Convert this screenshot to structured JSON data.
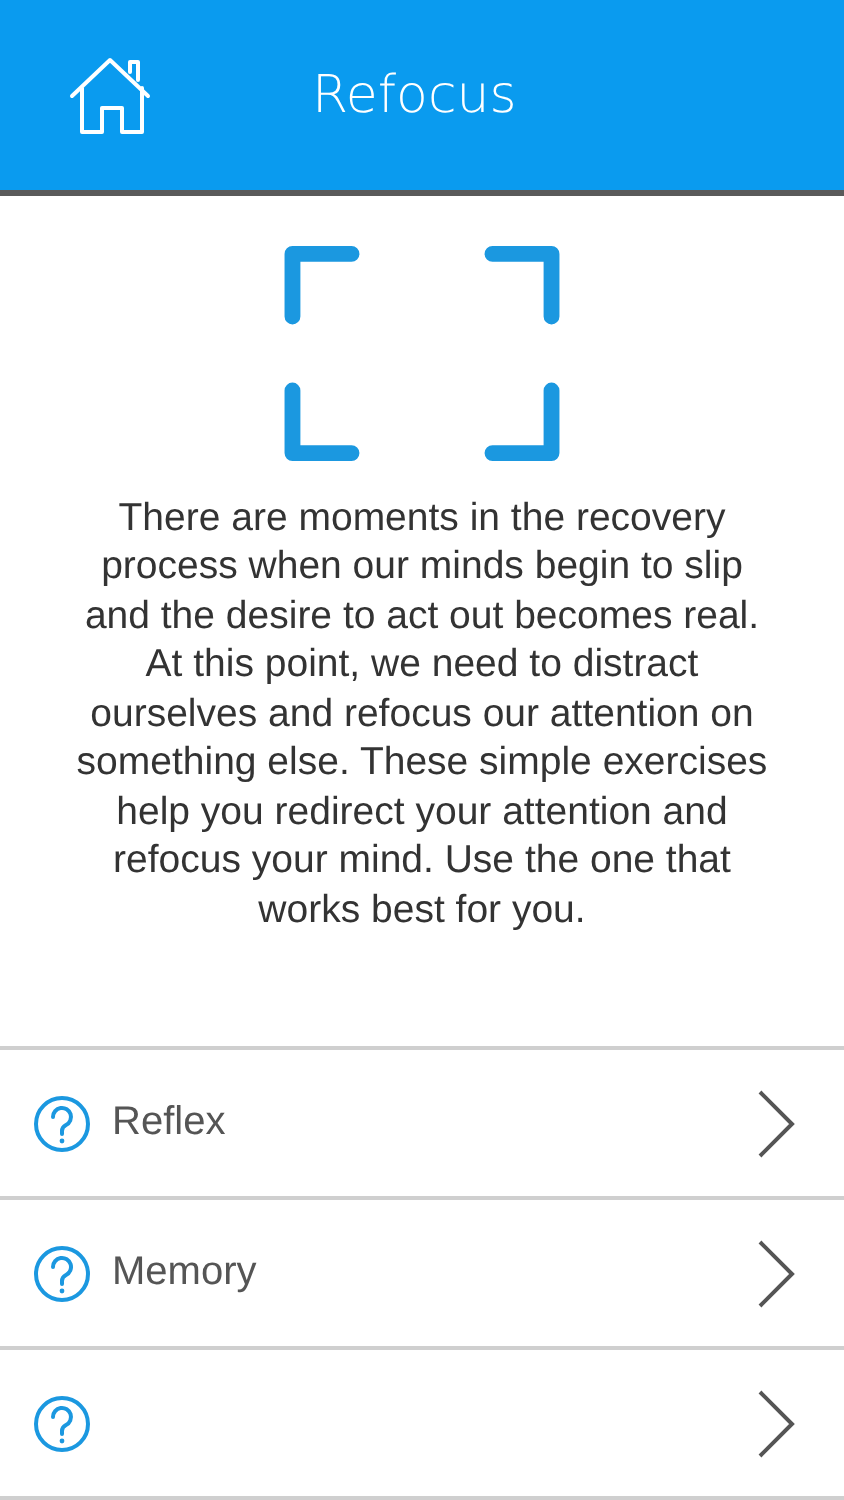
{
  "header": {
    "title": "Refocus"
  },
  "intro": "There are moments in the recovery process when our minds begin to slip and the desire to act out becomes real. At this point, we need to distract ourselves and refocus our attention on something else. These simple exercises help you redirect your attention and refocus your mind. Use the one that works best for you.",
  "exercises": [
    {
      "kind": "full",
      "label": "Reflex"
    },
    {
      "kind": "full",
      "label": "Memory"
    },
    {
      "kind": "cut"
    }
  ]
}
